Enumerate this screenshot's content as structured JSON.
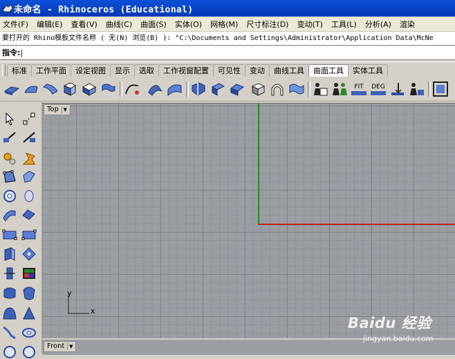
{
  "window": {
    "title": "未命名 - Rhinoceros (Educational)"
  },
  "menu": [
    "文件(F)",
    "编辑(E)",
    "查看(V)",
    "曲线(C)",
    "曲面(S)",
    "实体(O)",
    "网格(M)",
    "尺寸标注(D)",
    "变动(T)",
    "工具(L)",
    "分析(A)",
    "渲染"
  ],
  "command": {
    "history": "要打开的 Rhino模板文件名称 ( 无(N)  浏览(B) ): \"C:\\Documents and Settings\\Administrator\\Application Data\\McNe",
    "prompt": "指令:"
  },
  "tabs": [
    "标准",
    "工作平面",
    "设定视图",
    "显示",
    "选取",
    "工作视窗配置",
    "可见性",
    "变动",
    "曲线工具",
    "曲面工具",
    "实体工具"
  ],
  "active_tab": "曲面工具",
  "toolbar_text": {
    "fit": "FIT",
    "deg": "DEG"
  },
  "viewports": {
    "top": "Top",
    "front": "Front"
  },
  "cplane_axes": {
    "y": "y",
    "x": "x"
  },
  "watermark": {
    "brand": "Baidu 经验",
    "sub": "jingyan.baidu.com"
  },
  "colors": {
    "title_bar": "#0842c4",
    "x_axis": "#c0261a",
    "y_axis": "#1f8f1f",
    "viewport_bg": "#9a9ea3"
  }
}
